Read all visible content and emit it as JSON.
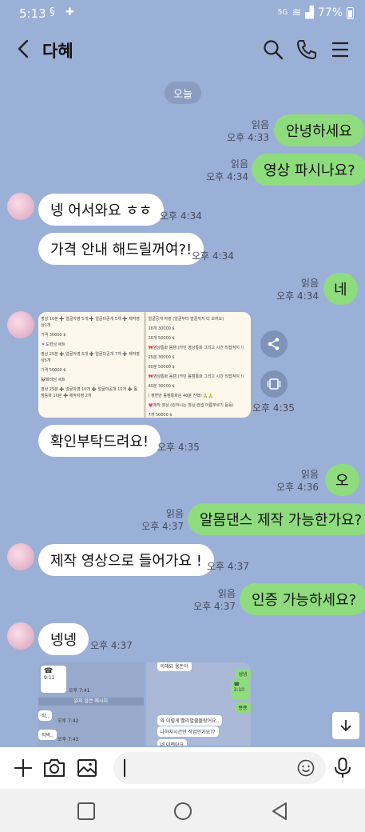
{
  "status": {
    "time": "5:13",
    "network": "5G",
    "battery": "77%"
  },
  "header": {
    "title": "다혜"
  },
  "date_chip": "오늘",
  "messages": [
    {
      "from": "me",
      "text": "안녕하세요",
      "read": "읽음",
      "time": "오후 4:33"
    },
    {
      "from": "me",
      "text": "영상 파시나요?",
      "read": "읽음",
      "time": "오후 4:34"
    },
    {
      "from": "them",
      "text": "넹 어서와요 ㅎㅎ",
      "time": "오후 4:34"
    },
    {
      "from": "them",
      "text": "가격 안내 해드릴꺼여?!",
      "time": "오후 4:34"
    },
    {
      "from": "me",
      "text": "네",
      "read": "읽음",
      "time": "오후 4:34"
    },
    {
      "from": "them",
      "type": "image",
      "time": "오후 4:35"
    },
    {
      "from": "them",
      "text": "확인부탁드려요!",
      "time": "오후 4:35"
    },
    {
      "from": "me",
      "text": "오",
      "read": "읽음",
      "time": "오후 4:36"
    },
    {
      "from": "me",
      "text": "알몸댄스 제작 가능한가요?",
      "read": "읽음",
      "time": "오후 4:37"
    },
    {
      "from": "them",
      "text": "제작 영상으로 들어가요 !",
      "time": "오후 4:37"
    },
    {
      "from": "me",
      "text": "인증 가능하세요?",
      "read": "읽음",
      "time": "오후 4:37"
    },
    {
      "from": "them",
      "text": "넹넹",
      "time": "오후 4:37"
    }
  ],
  "image_left_lines": [
    "영상 10분 ➕ 얼굴자영 5개 ➕ 얼굴미공개 5개 ➕ 제작영상1개",
    "가격 30000 $",
    "💌도련님 세트",
    "영상 25분 ➕ 얼굴자영 5개 ➕ 얼굴미공개 7개 ➕ 제작영상5개",
    "가격 50000 $",
    "🐼화려님 세트",
    "영상 25분 ➕ 얼굴자영 10개 ➕ 얼굴미공개 10개 ➕ 몸캠동화 10분 ➕ 제작자영 2개"
  ],
  "image_right_lines": [
    "얼굴공개 자영 (얼굴부터 발끝까지 다 보여요)",
    "10개 30000 $",
    "20개 50000 $",
    "🎀영상통화 몸캠 (카민 영상통화 그리고 시간 직접적지 !)",
    "25분 30000 $",
    "60분 50000 $",
    "🎀영상통화 몸캠 (카민 몸캠통화 그리고 시간 직접적지 !)",
    "40분 30000 $",
    "( 정면만 몸캠통화은 40분 진행) 🙏🙏",
    "💗제작 영상 (원하시는 영상 컨셉 이름부르기 등등)",
    "7개 50000 $",
    "1개 가격 30000"
  ],
  "preview": {
    "left": {
      "call": "9:11",
      "time_a": "오후 7:41",
      "unread_banner": "읽지 않은 메시지",
      "msg_a": "작..",
      "time_b": "오후 7:42",
      "msg_b": "작박..",
      "time_c": "오후 7:43"
    },
    "right": {
      "top": "이해요 용돈이",
      "reply_a": "넹넹",
      "call": "3:10",
      "reply_b": "뿅뿅",
      "msg_a": "와 이렇게 빨리벌줄몰랐어요..",
      "msg_b": "나하자시간인 작업인가요??",
      "msg_c": "네 이젠어요"
    }
  },
  "input": {
    "placeholder": ""
  }
}
